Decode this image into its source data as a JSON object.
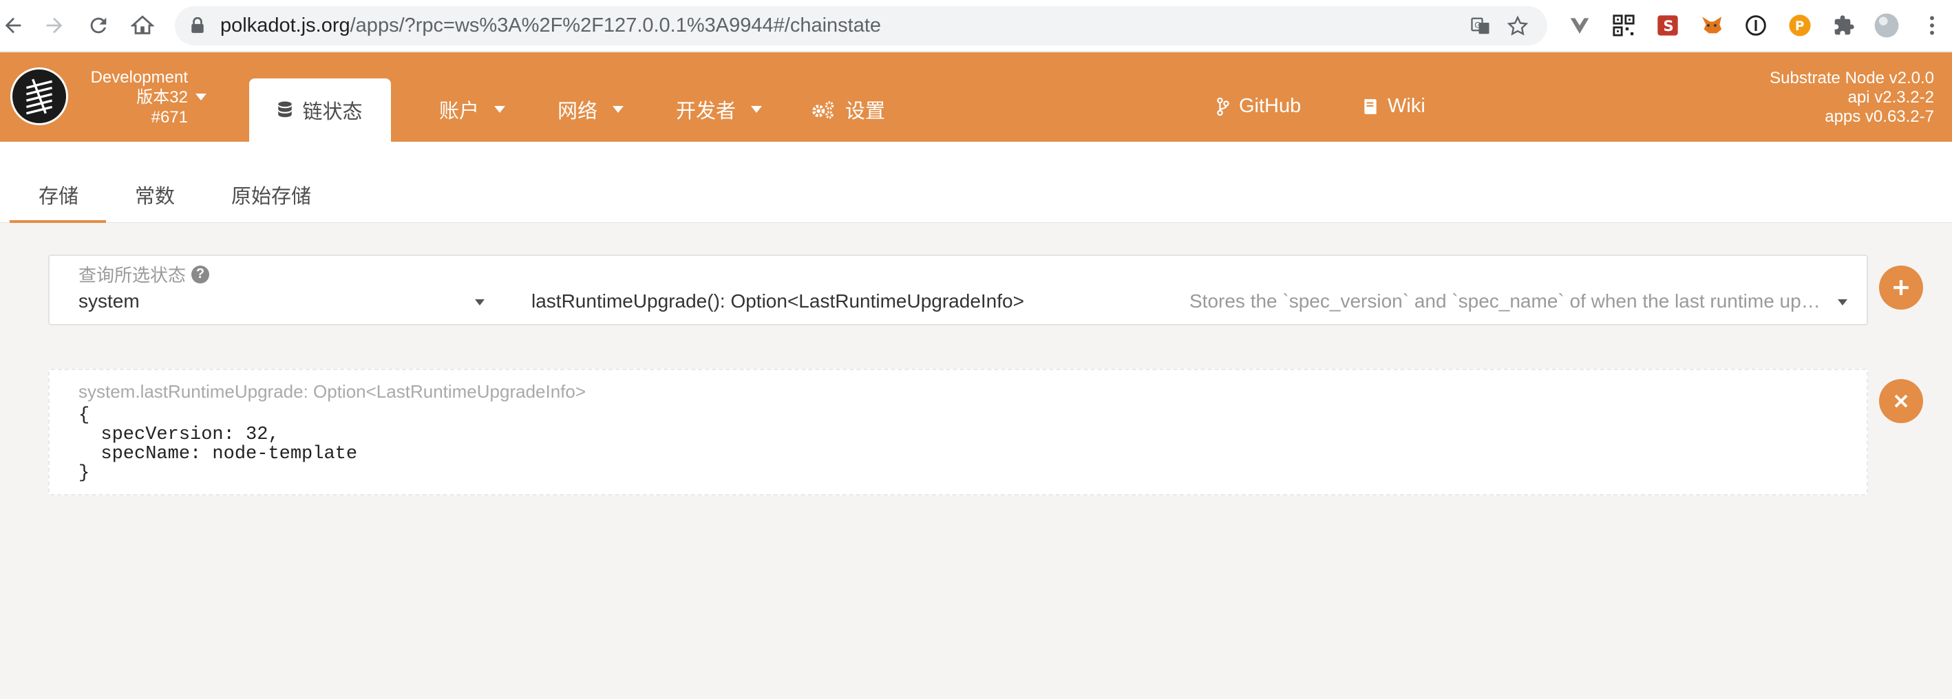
{
  "browser": {
    "url_host": "polkadot.js.org",
    "url_path": "/apps/?rpc=ws%3A%2F%2F127.0.0.1%3A9944#/chainstate"
  },
  "header": {
    "chain_name": "Development",
    "version": "版本32",
    "block": "#671",
    "active_tab": "链状态",
    "menu": {
      "accounts": "账户",
      "network": "网络",
      "developer": "开发者",
      "settings": "设置",
      "github": "GitHub",
      "wiki": "Wiki"
    },
    "node_info": {
      "node": "Substrate Node v2.0.0",
      "api": "api v2.3.2-2",
      "apps": "apps v0.63.2-7"
    }
  },
  "subtabs": {
    "storage": "存储",
    "constants": "常数",
    "raw_storage": "原始存储"
  },
  "query": {
    "label": "查询所选状态",
    "help": "?",
    "module": "system",
    "method": "lastRuntimeUpgrade(): Option<LastRuntimeUpgradeInfo>",
    "description": "Stores the `spec_version` and `spec_name` of when the last runtime upgrade happened."
  },
  "result": {
    "label": "system.lastRuntimeUpgrade: Option<LastRuntimeUpgradeInfo>",
    "code": "{\n  specVersion: 32,\n  specName: node-template\n}"
  },
  "colors": {
    "accent": "#e38d46",
    "background": "#f5f4f3"
  }
}
